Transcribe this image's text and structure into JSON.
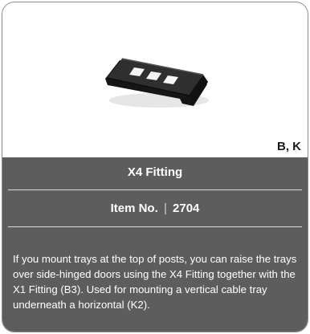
{
  "product": {
    "codes": "B, K",
    "title": "X4 Fitting",
    "item_label": "Item No.",
    "item_separator": "|",
    "item_number": "2704",
    "description": "If you mount trays at the top of posts, you can raise the trays over side-hinged doors using the X4 Fitting together with the X1 Fitting (B3). Used for mounting a vertical cable tray underneath a horizontal (K2)."
  },
  "colors": {
    "panel": "#5d5d5d",
    "card_border": "#8c8c8c",
    "text_light": "#ffffff"
  },
  "icons": {
    "product_image": "x4-fitting-image"
  }
}
